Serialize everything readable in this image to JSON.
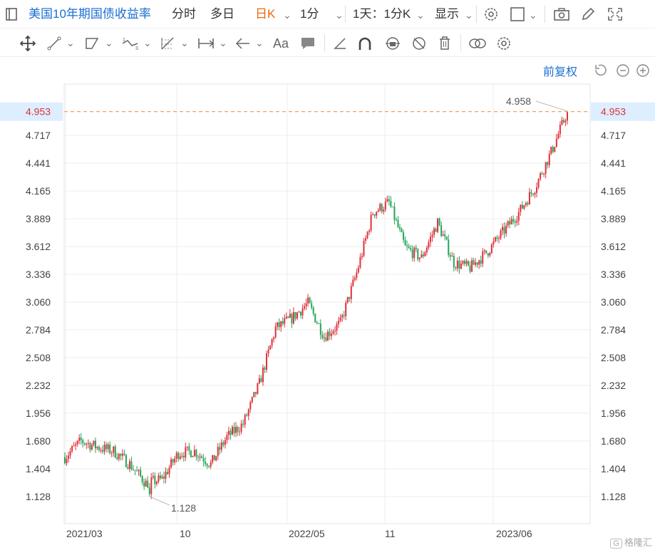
{
  "toolbar": {
    "title": "美国10年期国债收益率",
    "intraday": "分时",
    "multiday": "多日",
    "daily_k": "日K",
    "minute": "1分",
    "period": "1天：1分K",
    "display": "显示"
  },
  "chart_controls": {
    "adjust": "前复权"
  },
  "watermark": "格隆汇",
  "colors": {
    "accent": "#1a6fd1",
    "up": "#e0303a",
    "down": "#27a35a",
    "reference_line": "#f0a060",
    "current_price_bg": "#ddeeff"
  },
  "icons": [
    "panel-toggle-icon",
    "settings-icon",
    "layout-icon",
    "camera-icon",
    "pencil-icon",
    "fullscreen-icon",
    "move-icon",
    "line-tool-icon",
    "channel-tool-icon",
    "pattern-tool-icon",
    "fib-tool-icon",
    "measure-tool-icon",
    "arrow-tool-icon",
    "text-tool-icon",
    "comment-icon",
    "angle-icon",
    "magnet-icon",
    "lock-icon",
    "hide-icon",
    "delete-icon",
    "link-icon",
    "gear-icon",
    "reset-icon",
    "zoom-out-icon",
    "zoom-in-icon"
  ],
  "chart_data": {
    "type": "candlestick",
    "title": "美国10年期国债收益率",
    "x_ticks": [
      "2021/03",
      "10",
      "2022/05",
      "11",
      "2023/06"
    ],
    "y_ticks": [
      "1.128",
      "1.404",
      "1.680",
      "1.956",
      "2.232",
      "2.508",
      "2.784",
      "3.060",
      "3.336",
      "3.612",
      "3.889",
      "4.165",
      "4.441",
      "4.717"
    ],
    "ylim": [
      1.05,
      5.05
    ],
    "current_value": "4.953",
    "max_label": "4.958",
    "min_label": "1.128",
    "grid": true,
    "x": [
      "2021-03",
      "2021-04",
      "2021-05",
      "2021-06",
      "2021-07",
      "2021-08",
      "2021-09",
      "2021-10",
      "2021-11",
      "2021-12",
      "2022-01",
      "2022-02",
      "2022-03",
      "2022-04",
      "2022-05",
      "2022-06",
      "2022-07",
      "2022-08",
      "2022-09",
      "2022-10",
      "2022-11",
      "2022-12",
      "2023-01",
      "2023-02",
      "2023-03",
      "2023-04",
      "2023-05",
      "2023-06",
      "2023-07",
      "2023-08",
      "2023-09",
      "2023-10"
    ],
    "values": [
      1.52,
      1.68,
      1.62,
      1.58,
      1.45,
      1.26,
      1.3,
      1.56,
      1.58,
      1.45,
      1.72,
      1.85,
      2.25,
      2.8,
      2.9,
      3.05,
      2.72,
      2.85,
      3.35,
      3.95,
      4.05,
      3.6,
      3.5,
      3.85,
      3.45,
      3.4,
      3.55,
      3.75,
      3.95,
      4.2,
      4.55,
      4.95
    ]
  }
}
